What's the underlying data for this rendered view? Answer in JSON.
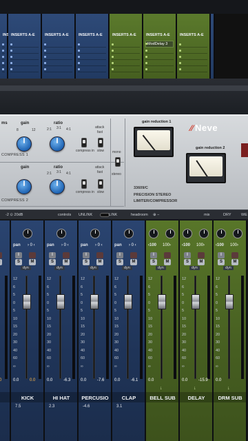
{
  "inserts": {
    "strips": [
      {
        "title": "INSERTS A-E",
        "color": "blue",
        "plugin": ""
      },
      {
        "title": "INSERTS A-E",
        "color": "blue",
        "plugin": ""
      },
      {
        "title": "INSERTS A-E",
        "color": "blue",
        "plugin": ""
      },
      {
        "title": "INSERTS A-E",
        "color": "blue",
        "plugin": ""
      },
      {
        "title": "INSERTS A-E",
        "color": "green",
        "plugin": ""
      },
      {
        "title": "INSERTS A-E",
        "color": "green",
        "plugin": "ModDelay 3"
      },
      {
        "title": "INSERTS A-E",
        "color": "green",
        "plugin": ""
      }
    ]
  },
  "compressor": {
    "row1": {
      "gain_label": "gain",
      "ratio_label": "ratio",
      "section": "COMPRESS 1",
      "attack": "attack",
      "fast": "fast",
      "slow": "slow",
      "compress_in": "compress in",
      "ms": "ms"
    },
    "row2": {
      "gain_label": "gain",
      "ratio_label": "ratio",
      "section": "COMPRESS 2",
      "attack": "attack",
      "fast": "fast",
      "slow": "slow",
      "compress_in": "compress in"
    },
    "mono": "mono",
    "stereo": "stereo",
    "meter1": "gain reduction 1",
    "meter2": "gain reduction 2",
    "brand": "Neve",
    "model": "33609/C",
    "desc1": "PRECISION STEREO",
    "desc2": "LIMITER/COMPRESSOR"
  },
  "controls_bar": {
    "range": "-2 ⊙ 20dB",
    "controls": "controls",
    "unlink": "UNLINK",
    "link": "LINK",
    "headroom": "headroom",
    "mix": "mix",
    "dry": "DRY",
    "wet": "WE"
  },
  "mixer": {
    "channels": [
      {
        "name": "",
        "pan_label": "pan",
        "pan_value": "",
        "volume": "0.0",
        "peak": "0.0",
        "peak_hot": true,
        "extra": "",
        "color": "blue"
      },
      {
        "name": "KICK",
        "pan_label": "pan",
        "pan_value": "› 0 ‹",
        "volume": "0.0",
        "peak": "0.0",
        "peak_hot": true,
        "extra": "7.5",
        "color": "blue"
      },
      {
        "name": "HI HAT",
        "pan_label": "pan",
        "pan_value": "› 0 ‹",
        "volume": "0.0",
        "peak": "-6.3",
        "peak_hot": false,
        "extra": "2.3",
        "color": "blue"
      },
      {
        "name": "PERCUSIO",
        "pan_label": "pan",
        "pan_value": "› 0 ‹",
        "volume": "0.0",
        "peak": "-7.6",
        "peak_hot": false,
        "extra": "-4.6",
        "color": "blue"
      },
      {
        "name": "CLAP",
        "pan_label": "pan",
        "pan_value": "› 0 ‹",
        "volume": "0.0",
        "peak": "-6.1",
        "peak_hot": false,
        "extra": "3.1",
        "color": "blue"
      },
      {
        "name": "BELL SUB",
        "pan_label": "‹100",
        "pan_value": "100›",
        "volume": "0.0",
        "peak": "",
        "peak_hot": false,
        "extra": "",
        "color": "green"
      },
      {
        "name": "DELAY",
        "pan_label": "‹100",
        "pan_value": "100›",
        "volume": "0.0",
        "peak": "-15.9",
        "peak_hot": false,
        "extra": "",
        "color": "green"
      },
      {
        "name": "DRM SUB",
        "pan_label": "‹100",
        "pan_value": "100›",
        "volume": "0.0",
        "peak": "",
        "peak_hot": false,
        "extra": "",
        "color": "green"
      }
    ],
    "scale": [
      "12",
      "6",
      "5",
      "0",
      "5",
      "10",
      "15",
      "20",
      "30",
      "40",
      "60",
      "∞"
    ],
    "buttons": {
      "input": "I",
      "solo": "S",
      "mute": "M",
      "dyn": "dyn"
    }
  }
}
